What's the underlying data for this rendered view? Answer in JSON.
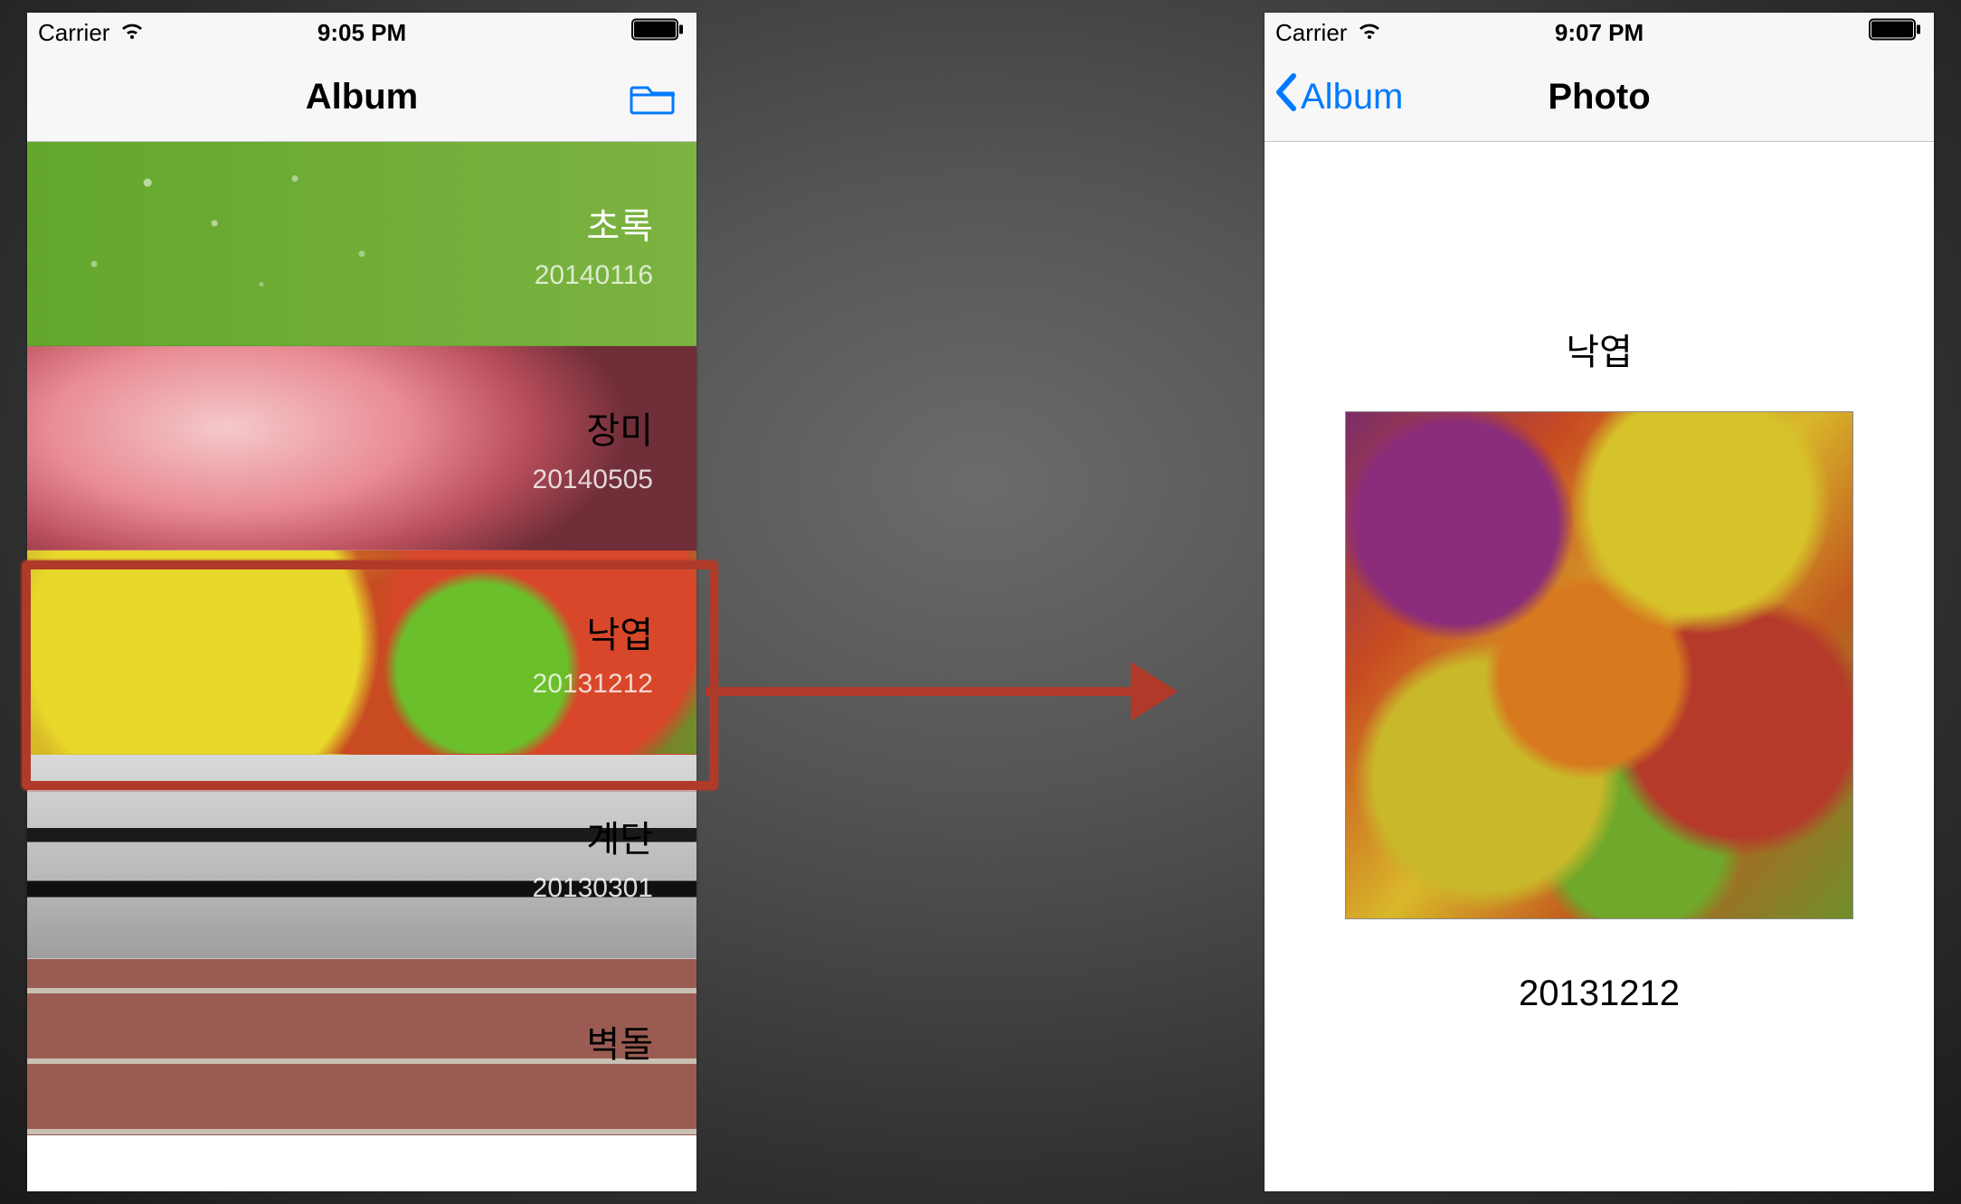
{
  "left": {
    "status": {
      "carrier": "Carrier",
      "time": "9:05 PM"
    },
    "nav": {
      "title": "Album"
    },
    "rows": [
      {
        "title": "초록",
        "date": "20140116"
      },
      {
        "title": "장미",
        "date": "20140505"
      },
      {
        "title": "낙엽",
        "date": "20131212"
      },
      {
        "title": "계단",
        "date": "20130301"
      },
      {
        "title": "벽돌",
        "date": ""
      }
    ]
  },
  "right": {
    "status": {
      "carrier": "Carrier",
      "time": "9:07 PM"
    },
    "nav": {
      "back": "Album",
      "title": "Photo"
    },
    "detail": {
      "title": "낙엽",
      "date": "20131212"
    }
  }
}
